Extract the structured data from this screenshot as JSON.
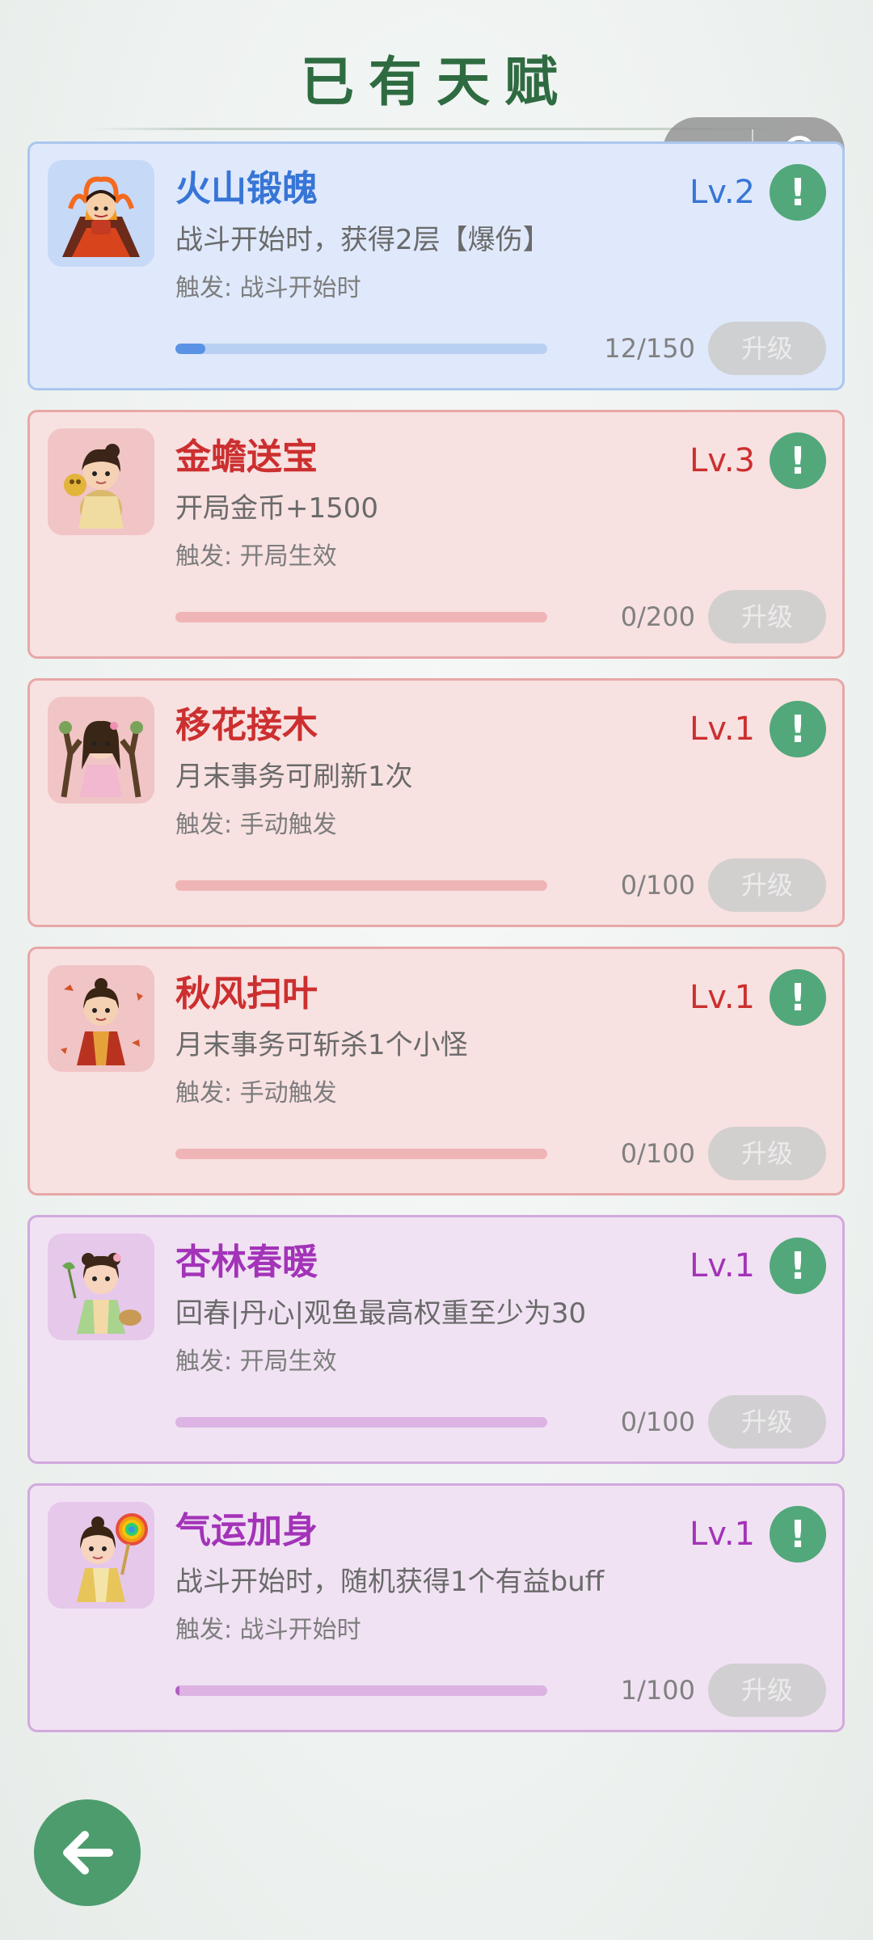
{
  "page": {
    "title": "已有天赋"
  },
  "talents": [
    {
      "name": "火山锻魄",
      "level": "Lv.2",
      "description": "战斗开始时，获得2层【爆伤】",
      "trigger": "触发: 战斗开始时",
      "progress_text": "12/150",
      "progress": 0.08,
      "upgrade_label": "升级",
      "theme": "blue",
      "info_symbol": "!"
    },
    {
      "name": "金蟾送宝",
      "level": "Lv.3",
      "description": "开局金币+1500",
      "trigger": "触发: 开局生效",
      "progress_text": "0/200",
      "progress": 0.0,
      "upgrade_label": "升级",
      "theme": "red",
      "info_symbol": "!"
    },
    {
      "name": "移花接木",
      "level": "Lv.1",
      "description": "月末事务可刷新1次",
      "trigger": "触发: 手动触发",
      "progress_text": "0/100",
      "progress": 0.0,
      "upgrade_label": "升级",
      "theme": "red",
      "info_symbol": "!"
    },
    {
      "name": "秋风扫叶",
      "level": "Lv.1",
      "description": "月末事务可斩杀1个小怪",
      "trigger": "触发: 手动触发",
      "progress_text": "0/100",
      "progress": 0.0,
      "upgrade_label": "升级",
      "theme": "red",
      "info_symbol": "!"
    },
    {
      "name": "杏林春暖",
      "level": "Lv.1",
      "description": "回春|丹心|观鱼最高权重至少为30",
      "trigger": "触发: 开局生效",
      "progress_text": "0/100",
      "progress": 0.0,
      "upgrade_label": "升级",
      "theme": "purple",
      "info_symbol": "!"
    },
    {
      "name": "气运加身",
      "level": "Lv.1",
      "description": "战斗开始时，随机获得1个有益buff",
      "trigger": "触发: 战斗开始时",
      "progress_text": "1/100",
      "progress": 0.01,
      "upgrade_label": "升级",
      "theme": "purple",
      "info_symbol": "!"
    }
  ],
  "colors": {
    "accent_green": "#52a87a",
    "title_green": "#2f6b41",
    "blue": "#3775d6",
    "red": "#cc2f2f",
    "purple": "#a333b8"
  },
  "icons": {
    "back": "arrow-left-icon",
    "more": "more-dots-icon",
    "close": "capsule-close-icon",
    "info": "exclamation-icon"
  }
}
